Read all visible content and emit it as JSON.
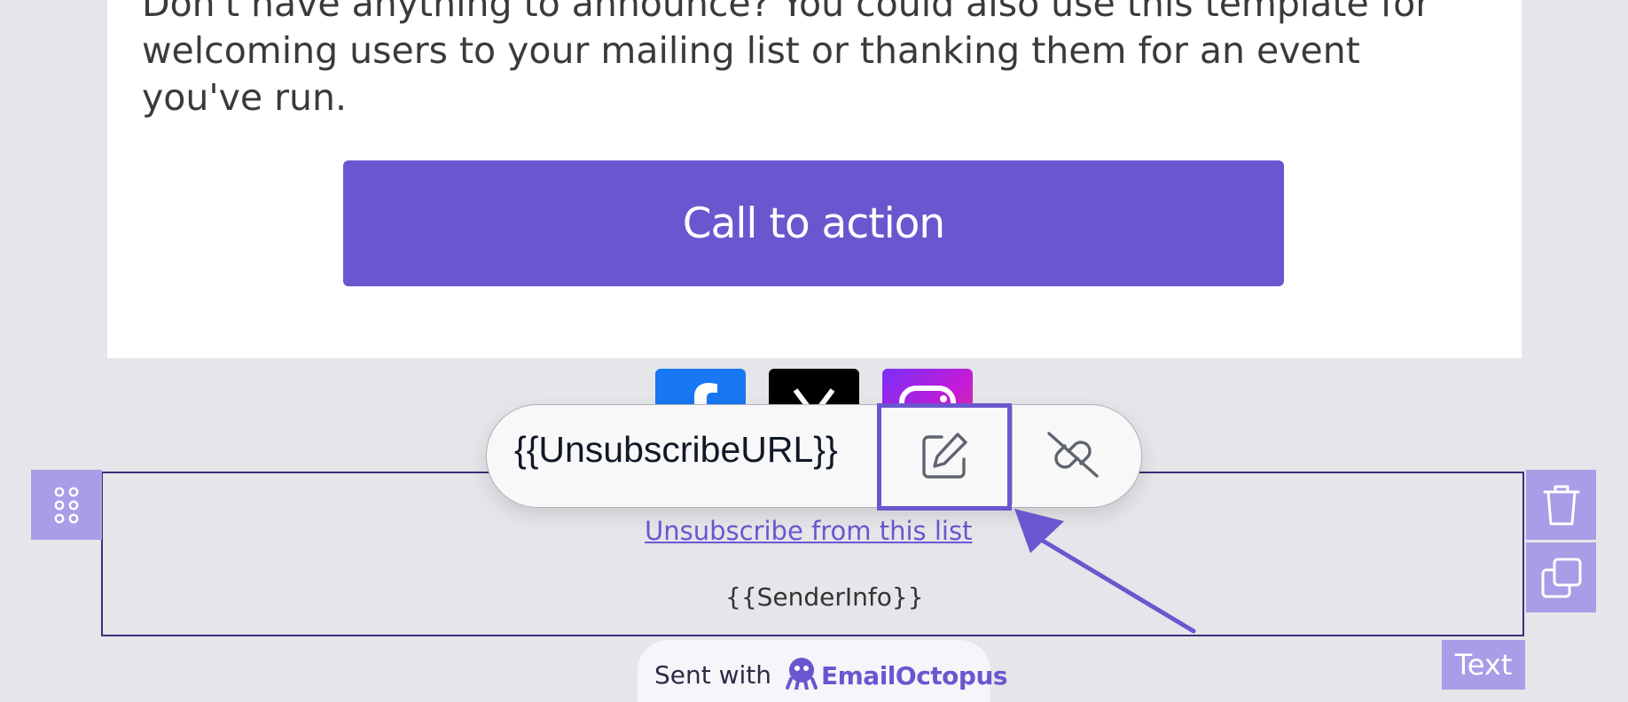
{
  "email": {
    "body_text": "Don't have anything to announce? You could also use this template for welcoming users to your mailing list or thanking them for an event you've run.",
    "cta_label": "Call to action",
    "social_icons": [
      "facebook-icon",
      "x-icon",
      "instagram-icon"
    ]
  },
  "footer": {
    "unsubscribe_label": "Unsubscribe from this list",
    "sender_info": "{{SenderInfo}}"
  },
  "link_popup": {
    "url": "{{UnsubscribeURL}}",
    "edit_icon": "pencil-square-icon",
    "unlink_icon": "unlink-icon"
  },
  "block_controls": {
    "drag_icon": "drag-handle-icon",
    "delete_icon": "trash-icon",
    "duplicate_icon": "copy-icon",
    "block_type": "Text"
  },
  "badge": {
    "sent_with": "Sent with",
    "brand": "EmailOctopus"
  },
  "colors": {
    "accent": "#6a57cf",
    "control_bg": "#a89de6",
    "canvas_bg": "#e5e6e9"
  }
}
